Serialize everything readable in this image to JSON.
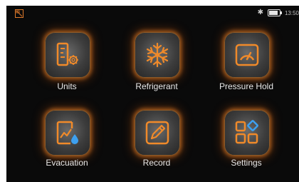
{
  "status": {
    "time": "13:50"
  },
  "menu": [
    {
      "id": "units",
      "label": "Units",
      "icon": "units-icon"
    },
    {
      "id": "refrigerant",
      "label": "Refrigerant",
      "icon": "snowflake-icon"
    },
    {
      "id": "pressure-hold",
      "label": "Pressure Hold",
      "icon": "gauge-icon"
    },
    {
      "id": "evacuation",
      "label": "Evacuation",
      "icon": "evacuation-chart-icon"
    },
    {
      "id": "record",
      "label": "Record",
      "icon": "pencil-edit-icon"
    },
    {
      "id": "settings",
      "label": "Settings",
      "icon": "apps-grid-icon"
    }
  ],
  "colors": {
    "accent": "#f08a2a",
    "background": "#0a0a0a",
    "label": "#e8e8e8"
  }
}
